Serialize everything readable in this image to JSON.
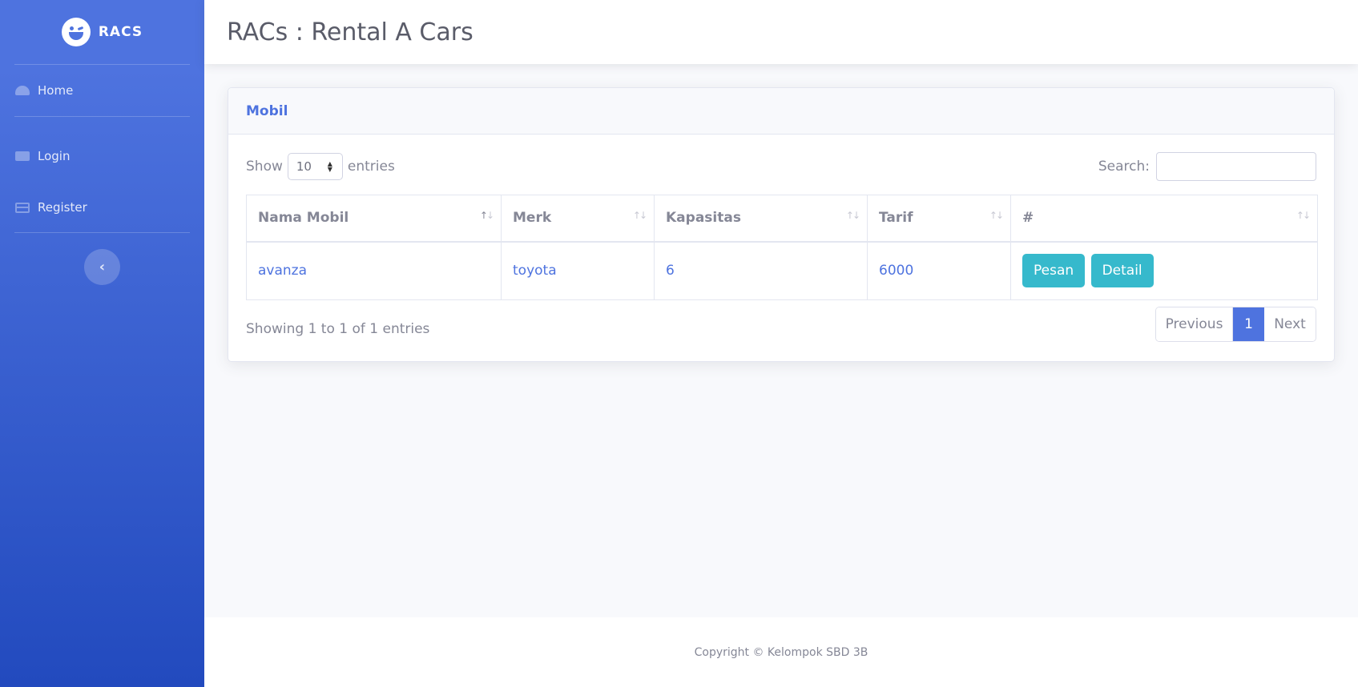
{
  "sidebar": {
    "brand": "RACS",
    "items": [
      {
        "label": "Home",
        "icon": "tachometer-icon"
      },
      {
        "label": "Login",
        "icon": "folder-icon"
      },
      {
        "label": "Register",
        "icon": "table-icon"
      }
    ],
    "toggle_icon": "‹"
  },
  "topbar": {
    "title": "RACs : Rental A Cars"
  },
  "card": {
    "title": "Mobil",
    "show_label": "Show",
    "entries_value": "10",
    "entries_label": "entries",
    "search_label": "Search:",
    "search_value": "",
    "columns": [
      "Nama Mobil",
      "Merk",
      "Kapasitas",
      "Tarif",
      "#"
    ],
    "rows": [
      {
        "nama": "avanza",
        "merk": "toyota",
        "kapasitas": "6",
        "tarif": "6000",
        "actions": [
          "Pesan",
          "Detail"
        ]
      }
    ],
    "info": "Showing 1 to 1 of 1 entries",
    "pagination": {
      "previous": "Previous",
      "current": "1",
      "next": "Next"
    }
  },
  "footer": {
    "text": "Copyright © Kelompok SBD 3B"
  },
  "colors": {
    "primary": "#4e73df",
    "info": "#36b9cc",
    "text": "#858796"
  }
}
